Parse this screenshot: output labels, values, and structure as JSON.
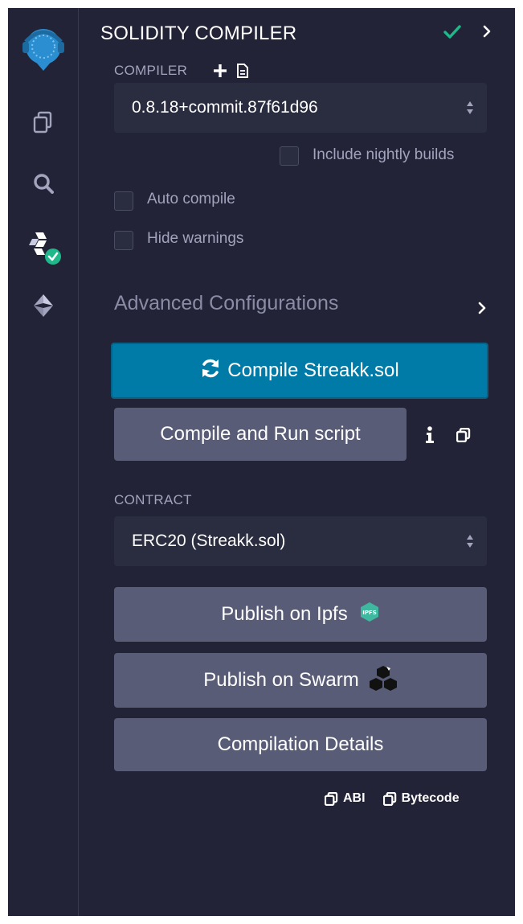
{
  "colors": {
    "background": "#222336",
    "panel_input": "#2a2c3f",
    "primary_button": "#007aa6",
    "secondary_button": "#595c76",
    "accent_green": "#1fb88a",
    "logo_blue": "#2b8ed1",
    "text_muted": "#a2a3bd"
  },
  "icon_bar": {
    "logo_icon": "remix-logo-icon",
    "items": [
      {
        "icon": "file-explorer-icon"
      },
      {
        "icon": "search-icon"
      },
      {
        "icon": "solidity-compiler-icon",
        "active": true
      },
      {
        "icon": "deploy-run-icon"
      }
    ]
  },
  "header": {
    "title": "SOLIDITY COMPILER",
    "status_icon": "check-icon",
    "expand_icon": "chevron-right-icon"
  },
  "compiler": {
    "label": "COMPILER",
    "add_icon": "plus-icon",
    "file_icon": "file-icon",
    "version": "0.8.18+commit.87f61d96",
    "nightly_label": "Include nightly builds",
    "nightly_checked": false
  },
  "options": {
    "auto_compile_label": "Auto compile",
    "auto_compile_checked": false,
    "hide_warnings_label": "Hide warnings",
    "hide_warnings_checked": false
  },
  "advanced": {
    "label": "Advanced Configurations"
  },
  "buttons": {
    "compile_label": "Compile Streakk.sol",
    "compile_icon": "refresh-icon",
    "compile_run_label": "Compile and Run script",
    "info_icon": "info-icon",
    "copy_icon": "copy-icon"
  },
  "contract": {
    "label": "CONTRACT",
    "selected": "ERC20 (Streakk.sol)"
  },
  "publish": {
    "ipfs_label": "Publish on Ipfs",
    "ipfs_badge": "IPFS",
    "swarm_label": "Publish on Swarm",
    "details_label": "Compilation Details"
  },
  "footer": {
    "abi_label": "ABI",
    "bytecode_label": "Bytecode"
  }
}
